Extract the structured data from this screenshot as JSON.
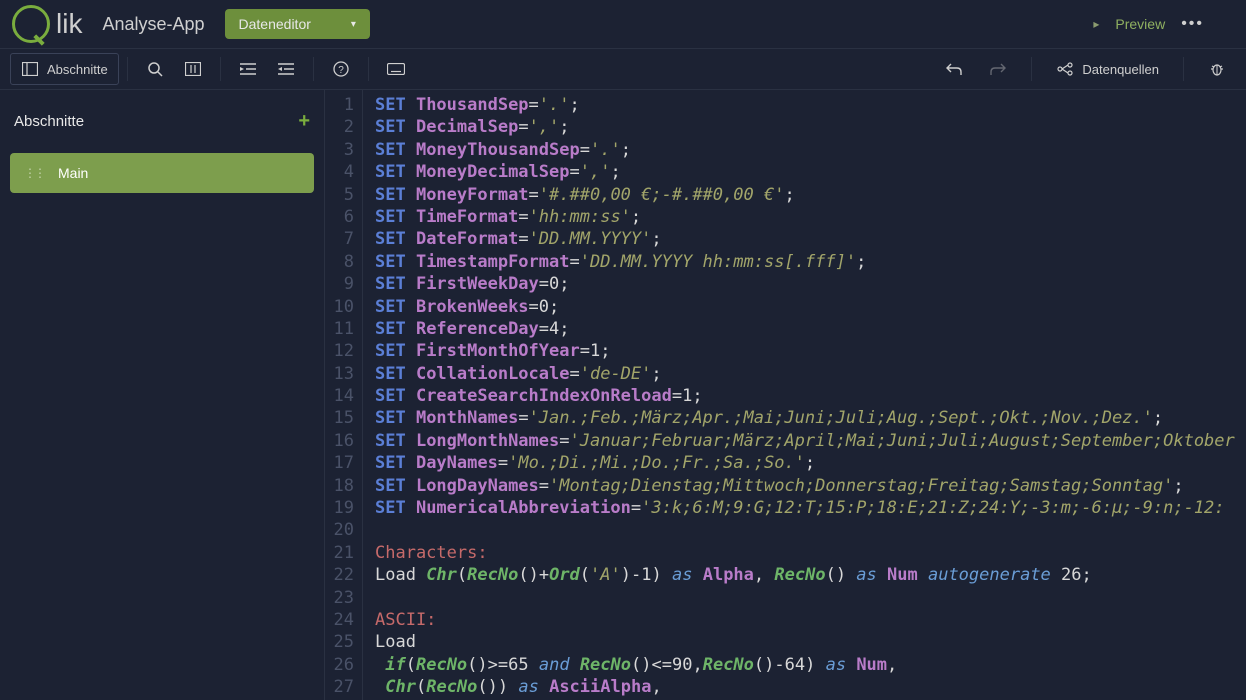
{
  "header": {
    "logo_text": "lik",
    "app_name": "Analyse-App",
    "dropdown_label": "Dateneditor",
    "preview_label": "Preview"
  },
  "toolbar": {
    "sections_label": "Abschnitte",
    "data_sources_label": "Datenquellen"
  },
  "sidebar": {
    "title": "Abschnitte",
    "items": [
      {
        "label": "Main"
      }
    ]
  },
  "code": {
    "lines": [
      {
        "n": 1,
        "tokens": [
          [
            "kw",
            "SET "
          ],
          [
            "ident",
            "ThousandSep"
          ],
          [
            "op",
            "="
          ],
          [
            "str",
            "'.'"
          ],
          [
            "punct",
            ";"
          ]
        ]
      },
      {
        "n": 2,
        "tokens": [
          [
            "kw",
            "SET "
          ],
          [
            "ident",
            "DecimalSep"
          ],
          [
            "op",
            "="
          ],
          [
            "str",
            "','"
          ],
          [
            "punct",
            ";"
          ]
        ]
      },
      {
        "n": 3,
        "tokens": [
          [
            "kw",
            "SET "
          ],
          [
            "ident",
            "MoneyThousandSep"
          ],
          [
            "op",
            "="
          ],
          [
            "str",
            "'.'"
          ],
          [
            "punct",
            ";"
          ]
        ]
      },
      {
        "n": 4,
        "tokens": [
          [
            "kw",
            "SET "
          ],
          [
            "ident",
            "MoneyDecimalSep"
          ],
          [
            "op",
            "="
          ],
          [
            "str",
            "','"
          ],
          [
            "punct",
            ";"
          ]
        ]
      },
      {
        "n": 5,
        "tokens": [
          [
            "kw",
            "SET "
          ],
          [
            "ident",
            "MoneyFormat"
          ],
          [
            "op",
            "="
          ],
          [
            "str",
            "'#.##0,00 €;-#.##0,00 €'"
          ],
          [
            "punct",
            ";"
          ]
        ]
      },
      {
        "n": 6,
        "tokens": [
          [
            "kw",
            "SET "
          ],
          [
            "ident",
            "TimeFormat"
          ],
          [
            "op",
            "="
          ],
          [
            "str",
            "'hh:mm:ss'"
          ],
          [
            "punct",
            ";"
          ]
        ]
      },
      {
        "n": 7,
        "tokens": [
          [
            "kw",
            "SET "
          ],
          [
            "ident",
            "DateFormat"
          ],
          [
            "op",
            "="
          ],
          [
            "str",
            "'DD.MM.YYYY'"
          ],
          [
            "punct",
            ";"
          ]
        ]
      },
      {
        "n": 8,
        "tokens": [
          [
            "kw",
            "SET "
          ],
          [
            "ident",
            "TimestampFormat"
          ],
          [
            "op",
            "="
          ],
          [
            "str",
            "'DD.MM.YYYY hh:mm:ss[.fff]'"
          ],
          [
            "punct",
            ";"
          ]
        ]
      },
      {
        "n": 9,
        "tokens": [
          [
            "kw",
            "SET "
          ],
          [
            "ident",
            "FirstWeekDay"
          ],
          [
            "op",
            "="
          ],
          [
            "num",
            "0"
          ],
          [
            "punct",
            ";"
          ]
        ]
      },
      {
        "n": 10,
        "tokens": [
          [
            "kw",
            "SET "
          ],
          [
            "ident",
            "BrokenWeeks"
          ],
          [
            "op",
            "="
          ],
          [
            "num",
            "0"
          ],
          [
            "punct",
            ";"
          ]
        ]
      },
      {
        "n": 11,
        "tokens": [
          [
            "kw",
            "SET "
          ],
          [
            "ident",
            "ReferenceDay"
          ],
          [
            "op",
            "="
          ],
          [
            "num",
            "4"
          ],
          [
            "punct",
            ";"
          ]
        ]
      },
      {
        "n": 12,
        "tokens": [
          [
            "kw",
            "SET "
          ],
          [
            "ident",
            "FirstMonthOfYear"
          ],
          [
            "op",
            "="
          ],
          [
            "num",
            "1"
          ],
          [
            "punct",
            ";"
          ]
        ]
      },
      {
        "n": 13,
        "tokens": [
          [
            "kw",
            "SET "
          ],
          [
            "ident",
            "CollationLocale"
          ],
          [
            "op",
            "="
          ],
          [
            "str",
            "'de-DE'"
          ],
          [
            "punct",
            ";"
          ]
        ]
      },
      {
        "n": 14,
        "tokens": [
          [
            "kw",
            "SET "
          ],
          [
            "ident",
            "CreateSearchIndexOnReload"
          ],
          [
            "op",
            "="
          ],
          [
            "num",
            "1"
          ],
          [
            "punct",
            ";"
          ]
        ]
      },
      {
        "n": 15,
        "tokens": [
          [
            "kw",
            "SET "
          ],
          [
            "ident",
            "MonthNames"
          ],
          [
            "op",
            "="
          ],
          [
            "str",
            "'Jan.;Feb.;März;Apr.;Mai;Juni;Juli;Aug.;Sept.;Okt.;Nov.;Dez.'"
          ],
          [
            "punct",
            ";"
          ]
        ]
      },
      {
        "n": 16,
        "tokens": [
          [
            "kw",
            "SET "
          ],
          [
            "ident",
            "LongMonthNames"
          ],
          [
            "op",
            "="
          ],
          [
            "str",
            "'Januar;Februar;März;April;Mai;Juni;Juli;August;September;Oktober"
          ]
        ]
      },
      {
        "n": 17,
        "tokens": [
          [
            "kw",
            "SET "
          ],
          [
            "ident",
            "DayNames"
          ],
          [
            "op",
            "="
          ],
          [
            "str",
            "'Mo.;Di.;Mi.;Do.;Fr.;Sa.;So.'"
          ],
          [
            "punct",
            ";"
          ]
        ]
      },
      {
        "n": 18,
        "tokens": [
          [
            "kw",
            "SET "
          ],
          [
            "ident",
            "LongDayNames"
          ],
          [
            "op",
            "="
          ],
          [
            "str",
            "'Montag;Dienstag;Mittwoch;Donnerstag;Freitag;Samstag;Sonntag'"
          ],
          [
            "punct",
            ";"
          ]
        ]
      },
      {
        "n": 19,
        "tokens": [
          [
            "kw",
            "SET "
          ],
          [
            "ident",
            "NumericalAbbreviation"
          ],
          [
            "op",
            "="
          ],
          [
            "str",
            "'3:k;6:M;9:G;12:T;15:P;18:E;21:Z;24:Y;-3:m;-6:μ;-9:n;-12:"
          ]
        ]
      },
      {
        "n": 20,
        "tokens": []
      },
      {
        "n": 21,
        "tokens": [
          [
            "label",
            "Characters:"
          ]
        ]
      },
      {
        "n": 22,
        "tokens": [
          [
            "plain",
            "Load "
          ],
          [
            "func",
            "Chr"
          ],
          [
            "punct",
            "("
          ],
          [
            "func",
            "RecNo"
          ],
          [
            "punct",
            "()"
          ],
          [
            "op",
            "+"
          ],
          [
            "func",
            "Ord"
          ],
          [
            "punct",
            "("
          ],
          [
            "str",
            "'A'"
          ],
          [
            "punct",
            ")"
          ],
          [
            "op",
            "-"
          ],
          [
            "num",
            "1"
          ],
          [
            "punct",
            ") "
          ],
          [
            "kw2",
            "as "
          ],
          [
            "ident",
            "Alpha"
          ],
          [
            "punct",
            ", "
          ],
          [
            "func",
            "RecNo"
          ],
          [
            "punct",
            "() "
          ],
          [
            "kw2",
            "as "
          ],
          [
            "ident",
            "Num "
          ],
          [
            "kw2",
            "autogenerate "
          ],
          [
            "num",
            "26"
          ],
          [
            "punct",
            ";"
          ]
        ]
      },
      {
        "n": 23,
        "tokens": []
      },
      {
        "n": 24,
        "tokens": [
          [
            "label",
            "ASCII:"
          ]
        ]
      },
      {
        "n": 25,
        "tokens": [
          [
            "plain",
            "Load"
          ]
        ]
      },
      {
        "n": 26,
        "tokens": [
          [
            "plain",
            " "
          ],
          [
            "func",
            "if"
          ],
          [
            "punct",
            "("
          ],
          [
            "func",
            "RecNo"
          ],
          [
            "punct",
            "()"
          ],
          [
            "op",
            ">="
          ],
          [
            "num",
            "65 "
          ],
          [
            "kw2",
            "and "
          ],
          [
            "func",
            "RecNo"
          ],
          [
            "punct",
            "()"
          ],
          [
            "op",
            "<="
          ],
          [
            "num",
            "90"
          ],
          [
            "punct",
            ","
          ],
          [
            "func",
            "RecNo"
          ],
          [
            "punct",
            "()"
          ],
          [
            "op",
            "-"
          ],
          [
            "num",
            "64"
          ],
          [
            "punct",
            ") "
          ],
          [
            "kw2",
            "as "
          ],
          [
            "ident",
            "Num"
          ],
          [
            "punct",
            ","
          ]
        ]
      },
      {
        "n": 27,
        "tokens": [
          [
            "plain",
            " "
          ],
          [
            "func",
            "Chr"
          ],
          [
            "punct",
            "("
          ],
          [
            "func",
            "RecNo"
          ],
          [
            "punct",
            "()) "
          ],
          [
            "kw2",
            "as "
          ],
          [
            "ident",
            "AsciiAlpha"
          ],
          [
            "punct",
            ","
          ]
        ]
      }
    ]
  }
}
